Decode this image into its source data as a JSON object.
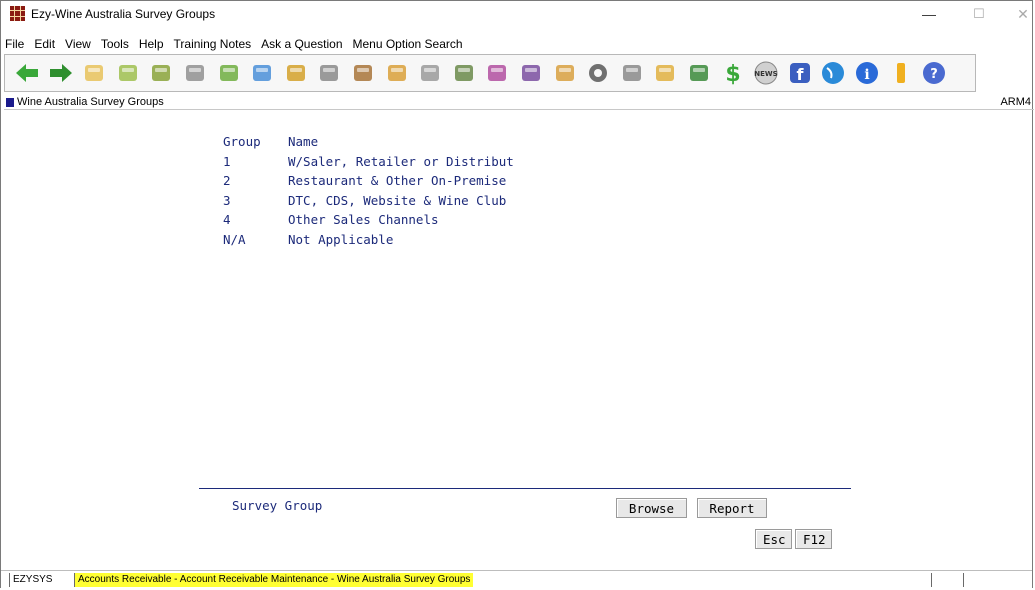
{
  "window": {
    "title": "Ezy-Wine Australia Survey Groups",
    "controls": {
      "minimize": "—",
      "maximize": "☐",
      "close": "✕"
    }
  },
  "menu": [
    "File",
    "Edit",
    "View",
    "Tools",
    "Help",
    "Training Notes",
    "Ask a Question",
    "Menu Option Search"
  ],
  "toolbar": {
    "icons": [
      "back-arrow-icon",
      "forward-arrow-icon",
      "folder-icon",
      "document-icon",
      "money-hand-icon",
      "printer-icon",
      "cash-icon",
      "monitor-icon",
      "people-icon",
      "wrench-icon",
      "barrel-icon",
      "box-icon",
      "tap-icon",
      "tractor-icon",
      "wine-glass-icon",
      "grapes-icon",
      "briefcase-icon",
      "gear-icon",
      "stop-icon",
      "cube-icon",
      "vine-leaf-icon",
      "dollar-icon",
      "news-icon",
      "facebook-icon",
      "globe-icon",
      "info-icon",
      "bookmark-icon",
      "help-icon"
    ],
    "colors": [
      "#3aa83a",
      "#2f8f2f",
      "#e8c25a",
      "#9fbf4f",
      "#8aa33a",
      "#909090",
      "#6fae3f",
      "#4a8fd8",
      "#d4a12a",
      "#8a8a8a",
      "#a8743a",
      "#d9a03a",
      "#9a9a9a",
      "#6a8a4a",
      "#b24fa0",
      "#7a4fa0",
      "#d8a040",
      "#707070",
      "#8a8a8a",
      "#e0b040",
      "#3a8a3a",
      "#3aa83a",
      "#d0d0d0",
      "#3b5fc0",
      "#2a8ad8",
      "#2a6ad8",
      "#f0b020",
      "#4a6ad0"
    ]
  },
  "header": {
    "label": "Wine Australia Survey Groups",
    "code": "ARM4"
  },
  "table": {
    "columns": {
      "group": "Group",
      "name": "Name"
    },
    "rows": [
      {
        "group": "1",
        "name": "W/Saler, Retailer or Distribut"
      },
      {
        "group": "2",
        "name": "Restaurant & Other On-Premise"
      },
      {
        "group": "3",
        "name": "DTC, CDS, Website & Wine Club"
      },
      {
        "group": "4",
        "name": "Other Sales Channels"
      },
      {
        "group": "N/A",
        "name": "Not Applicable"
      }
    ]
  },
  "footer": {
    "field_label": "Survey Group",
    "browse": "Browse",
    "report": "Report",
    "esc": "Esc",
    "f12": "F12"
  },
  "status": {
    "user": "EZYSYS",
    "path": "Accounts Receivable - Account Receivable Maintenance - Wine Australia Survey Groups",
    "highlight_color": "#ffff33"
  }
}
